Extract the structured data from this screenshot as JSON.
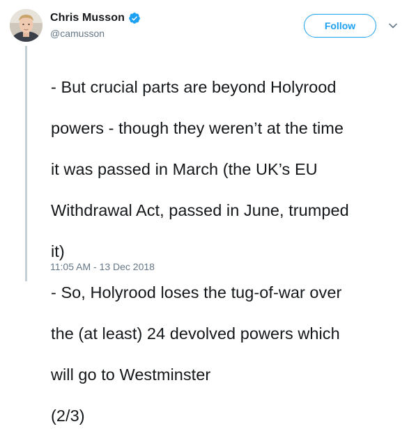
{
  "author": {
    "display_name": "Chris Musson",
    "handle": "@camusson",
    "verified": true
  },
  "actions": {
    "follow_label": "Follow"
  },
  "tweet": {
    "lines": [
      "- But crucial parts are beyond Holyrood",
      "powers - though they weren’t at the time",
      "it was passed in March (the UK’s EU",
      "Withdrawal Act, passed in June, trumped",
      "it)",
      "- So, Holyrood loses the tug-of-war over",
      "the (at least) 24 devolved powers which",
      "will go to Westminster",
      "(2/3)"
    ],
    "timestamp": "11:05 AM - 13 Dec 2018"
  },
  "colors": {
    "brand_blue": "#1da1f2",
    "secondary_text": "#657786",
    "thread_line": "#c4cfd6"
  },
  "icons": {
    "verified": "verified-badge-icon",
    "caret": "chevron-down-icon"
  }
}
